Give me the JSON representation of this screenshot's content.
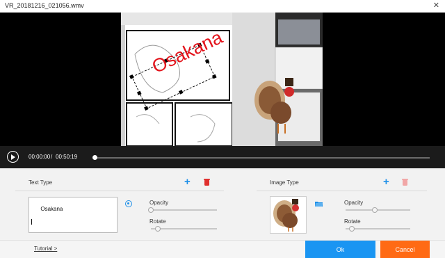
{
  "window": {
    "title": "VR_20181216_021056.wmv",
    "close_label": "✕"
  },
  "video": {
    "overlay_text": "Osakana",
    "overlay_color": "#e3141c"
  },
  "player": {
    "current_time": "00:00:00",
    "separator": "/",
    "duration": "00:50:19",
    "progress": 0
  },
  "text_section": {
    "title": "Text Type",
    "add_icon": "plus-icon",
    "delete_icon": "trash-icon",
    "text_value": "Osakana",
    "visibility_icon": "eye-icon",
    "opacity_label": "Opacity",
    "opacity_value": 0,
    "rotate_label": "Rotate",
    "rotate_value": 0.1
  },
  "image_section": {
    "title": "Image Type",
    "add_icon": "plus-icon",
    "delete_icon": "trash-icon",
    "browse_icon": "folder-icon",
    "opacity_label": "Opacity",
    "opacity_value": 0.45,
    "rotate_label": "Rotate",
    "rotate_value": 0.1
  },
  "footer": {
    "tutorial_label": "Tutorial >",
    "ok_label": "Ok",
    "cancel_label": "Cancel"
  },
  "colors": {
    "accent": "#1a95f2",
    "cancel": "#ff6a14",
    "delete": "#e0302e"
  }
}
